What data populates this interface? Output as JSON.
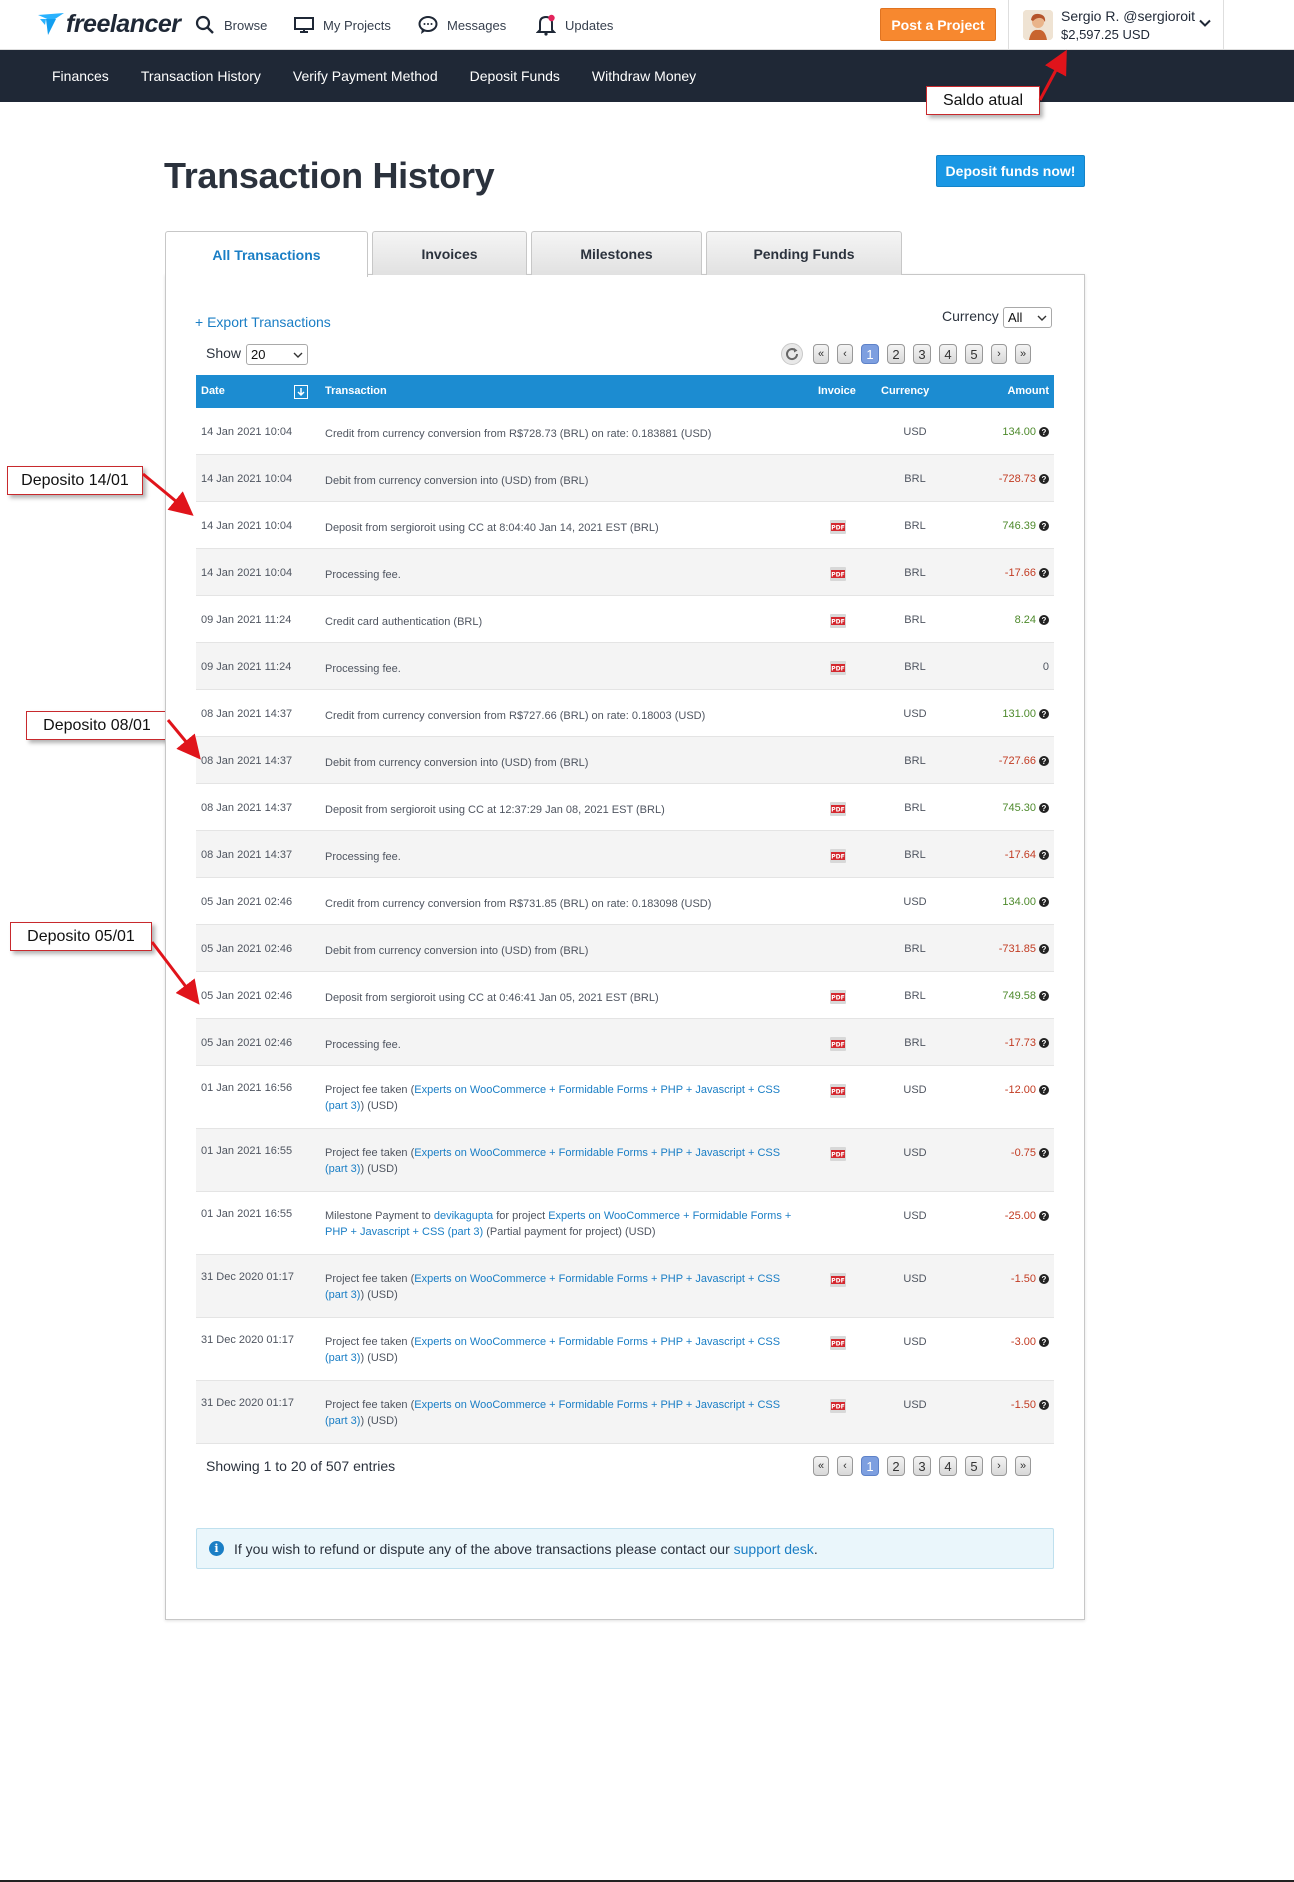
{
  "header": {
    "logo_text": "freelancer",
    "nav": [
      {
        "label": "Browse",
        "icon": "search-icon"
      },
      {
        "label": "My Projects",
        "icon": "monitor-icon"
      },
      {
        "label": "Messages",
        "icon": "chat-icon"
      },
      {
        "label": "Updates",
        "icon": "bell-icon"
      }
    ],
    "post_project": "Post a Project",
    "user_name": "Sergio R. @sergioroit",
    "user_balance": "$2,597.25 USD"
  },
  "subnav": [
    "Finances",
    "Transaction History",
    "Verify Payment Method",
    "Deposit Funds",
    "Withdraw Money"
  ],
  "annotations": {
    "saldo": "Saldo atual",
    "dep1": "Deposito 14/01",
    "dep2": "Deposito 08/01",
    "dep3": "Deposito 05/01"
  },
  "page": {
    "title": "Transaction History",
    "deposit_now": "Deposit funds now!",
    "tabs": [
      "All Transactions",
      "Invoices",
      "Milestones",
      "Pending Funds"
    ],
    "export": "+ Export Transactions",
    "currency_label": "Currency",
    "currency_value": "All",
    "show_label": "Show",
    "show_value": "20",
    "pages": [
      "«",
      "‹",
      "1",
      "2",
      "3",
      "4",
      "5",
      "›",
      "»"
    ],
    "showing": "Showing 1 to 20 of 507 entries",
    "notice_text": "If you wish to refund or dispute any of the above transactions please contact our",
    "notice_link": "support desk",
    "notice_end": "."
  },
  "table": {
    "headers": {
      "date": "Date",
      "transaction": "Transaction",
      "invoice": "Invoice",
      "currency": "Currency",
      "amount": "Amount"
    },
    "project_link": "Experts on WooCommerce + Formidable Forms + PHP + Javascript + CSS (part 3)",
    "rows": [
      {
        "date": "14 Jan 2021 10:04",
        "pre": "Credit from currency conversion from R$728.73 (BRL) on rate: 0.183881 (USD)",
        "pdf": false,
        "currency": "USD",
        "amount": "134.00",
        "sign": "pos"
      },
      {
        "date": "14 Jan 2021 10:04",
        "pre": "Debit from currency conversion into (USD) from (BRL)",
        "pdf": false,
        "currency": "BRL",
        "amount": "-728.73",
        "sign": "neg"
      },
      {
        "date": "14 Jan 2021 10:04",
        "pre": "Deposit from sergioroit using CC at 8:04:40 Jan 14, 2021 EST (BRL)",
        "pdf": true,
        "currency": "BRL",
        "amount": "746.39",
        "sign": "pos"
      },
      {
        "date": "14 Jan 2021 10:04",
        "pre": "Processing fee.",
        "pdf": true,
        "currency": "BRL",
        "amount": "-17.66",
        "sign": "neg"
      },
      {
        "date": "09 Jan 2021 11:24",
        "pre": "Credit card authentication (BRL)",
        "pdf": true,
        "currency": "BRL",
        "amount": "8.24",
        "sign": "pos"
      },
      {
        "date": "09 Jan 2021 11:24",
        "pre": "Processing fee.",
        "pdf": true,
        "currency": "BRL",
        "amount": "0",
        "sign": "zero"
      },
      {
        "date": "08 Jan 2021 14:37",
        "pre": "Credit from currency conversion from R$727.66 (BRL) on rate: 0.18003 (USD)",
        "pdf": false,
        "currency": "USD",
        "amount": "131.00",
        "sign": "pos"
      },
      {
        "date": "08 Jan 2021 14:37",
        "pre": "Debit from currency conversion into (USD) from (BRL)",
        "pdf": false,
        "currency": "BRL",
        "amount": "-727.66",
        "sign": "neg"
      },
      {
        "date": "08 Jan 2021 14:37",
        "pre": "Deposit from sergioroit using CC at 12:37:29 Jan 08, 2021 EST (BRL)",
        "pdf": true,
        "currency": "BRL",
        "amount": "745.30",
        "sign": "pos"
      },
      {
        "date": "08 Jan 2021 14:37",
        "pre": "Processing fee.",
        "pdf": true,
        "currency": "BRL",
        "amount": "-17.64",
        "sign": "neg"
      },
      {
        "date": "05 Jan 2021 02:46",
        "pre": "Credit from currency conversion from R$731.85 (BRL) on rate: 0.183098 (USD)",
        "pdf": false,
        "currency": "USD",
        "amount": "134.00",
        "sign": "pos"
      },
      {
        "date": "05 Jan 2021 02:46",
        "pre": "Debit from currency conversion into (USD) from (BRL)",
        "pdf": false,
        "currency": "BRL",
        "amount": "-731.85",
        "sign": "neg"
      },
      {
        "date": "05 Jan 2021 02:46",
        "pre": "Deposit from sergioroit using CC at 0:46:41 Jan 05, 2021 EST (BRL)",
        "pdf": true,
        "currency": "BRL",
        "amount": "749.58",
        "sign": "pos"
      },
      {
        "date": "05 Jan 2021 02:46",
        "pre": "Processing fee.",
        "pdf": true,
        "currency": "BRL",
        "amount": "-17.73",
        "sign": "neg"
      },
      {
        "date": "01 Jan 2021 16:56",
        "pre": "Project fee taken (",
        "link": "Experts on WooCommerce + Formidable Forms + PHP + Javascript + CSS (part 3)",
        "post": ") (USD)",
        "pdf": true,
        "currency": "USD",
        "amount": "-12.00",
        "sign": "neg"
      },
      {
        "date": "01 Jan 2021 16:55",
        "pre": "Project fee taken (",
        "link": "Experts on WooCommerce + Formidable Forms + PHP + Javascript + CSS (part 3)",
        "post": ") (USD)",
        "pdf": true,
        "currency": "USD",
        "amount": "-0.75",
        "sign": "neg"
      },
      {
        "date": "01 Jan 2021 16:55",
        "pre": "Milestone Payment to ",
        "user": "devikagupta",
        "mid": " for project ",
        "link": "Experts on WooCommerce + Formidable Forms + PHP + Javascript + CSS (part 3)",
        "post": " (Partial payment for project) (USD)",
        "pdf": false,
        "currency": "USD",
        "amount": "-25.00",
        "sign": "neg"
      },
      {
        "date": "31 Dec 2020 01:17",
        "pre": "Project fee taken (",
        "link": "Experts on WooCommerce + Formidable Forms + PHP + Javascript + CSS (part 3)",
        "post": ") (USD)",
        "pdf": true,
        "currency": "USD",
        "amount": "-1.50",
        "sign": "neg"
      },
      {
        "date": "31 Dec 2020 01:17",
        "pre": "Project fee taken (",
        "link": "Experts on WooCommerce + Formidable Forms + PHP + Javascript + CSS (part 3)",
        "post": ") (USD)",
        "pdf": true,
        "currency": "USD",
        "amount": "-3.00",
        "sign": "neg"
      },
      {
        "date": "31 Dec 2020 01:17",
        "pre": "Project fee taken (",
        "link": "Experts on WooCommerce + Formidable Forms + PHP + Javascript + CSS (part 3)",
        "post": ") (USD)",
        "pdf": true,
        "currency": "USD",
        "amount": "-1.50",
        "sign": "neg"
      }
    ]
  },
  "colors": {
    "nav_bg": "#1f2836",
    "accent": "#1a7ec5",
    "post_btn": "#f7882f",
    "table_head": "#1c8cd1",
    "positive": "#4e8a2c",
    "negative": "#c23b22",
    "callout_border": "#c8292d"
  }
}
